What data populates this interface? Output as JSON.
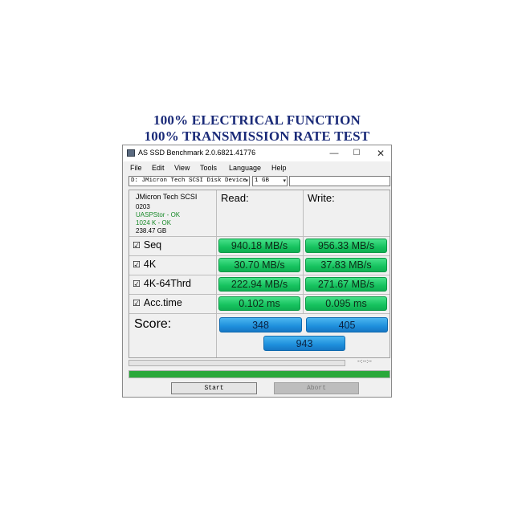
{
  "headline": {
    "line1": "100% ELECTRICAL FUNCTION",
    "line2": "100% TRANSMISSION RATE TEST"
  },
  "window": {
    "title": "AS SSD Benchmark 2.0.6821.41776",
    "controls": {
      "minimize": "—",
      "maximize": "☐",
      "close": "✕"
    },
    "menu": [
      "File",
      "Edit",
      "View",
      "Tools",
      "Language",
      "Help"
    ]
  },
  "toolbar": {
    "drive": "D: JMicron Tech SCSI Disk Device",
    "size": "1 GB",
    "extra": ""
  },
  "device_info": {
    "name": "JMicron Tech SCSI",
    "firmware": "0203",
    "driver": "UASPStor - OK",
    "alignment": "1024 K - OK",
    "capacity": "238.47 GB"
  },
  "columns": {
    "read": "Read:",
    "write": "Write:"
  },
  "tests": [
    {
      "label": "Seq",
      "read": "940.18 MB/s",
      "write": "956.33 MB/s"
    },
    {
      "label": "4K",
      "read": "30.70 MB/s",
      "write": "37.83 MB/s"
    },
    {
      "label": "4K-64Thrd",
      "read": "222.94 MB/s",
      "write": "271.67 MB/s"
    },
    {
      "label": "Acc.time",
      "read": "0.102 ms",
      "write": "0.095 ms"
    }
  ],
  "score": {
    "label": "Score:",
    "read": "348",
    "write": "405",
    "total": "943"
  },
  "status": {
    "elapsed": "--:--:--",
    "progress": 1.0
  },
  "buttons": {
    "start": "Start",
    "abort": "Abort"
  },
  "colors": {
    "headline": "#1a2a78",
    "result_green": "#16c35f",
    "score_blue": "#1e8fdc",
    "driver_ok": "#1a8a2a",
    "progress_green": "#2aa83a"
  }
}
